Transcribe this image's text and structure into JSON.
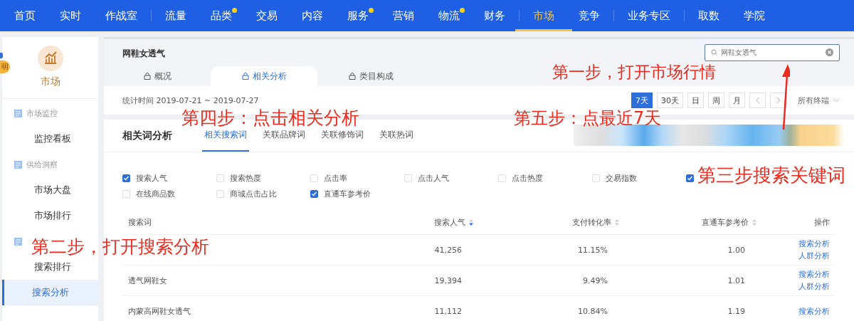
{
  "top_nav": {
    "groups": [
      {
        "items": [
          {
            "label": "首页",
            "selected": false,
            "dot": false
          },
          {
            "label": "实时",
            "selected": false,
            "dot": false
          },
          {
            "label": "作战室",
            "selected": false,
            "dot": false
          }
        ]
      },
      {
        "items": [
          {
            "label": "流量",
            "selected": false,
            "dot": false
          },
          {
            "label": "品类",
            "selected": false,
            "dot": true
          },
          {
            "label": "交易",
            "selected": false,
            "dot": false
          },
          {
            "label": "内容",
            "selected": false,
            "dot": false
          },
          {
            "label": "服务",
            "selected": false,
            "dot": true
          },
          {
            "label": "营销",
            "selected": false,
            "dot": false
          },
          {
            "label": "物流",
            "selected": false,
            "dot": true
          },
          {
            "label": "财务",
            "selected": false,
            "dot": false
          }
        ]
      },
      {
        "items": [
          {
            "label": "市场",
            "selected": true,
            "dot": false
          },
          {
            "label": "竞争",
            "selected": false,
            "dot": false
          }
        ]
      },
      {
        "items": [
          {
            "label": "业务专区",
            "selected": false,
            "dot": false
          }
        ]
      },
      {
        "items": [
          {
            "label": "取数",
            "selected": false,
            "dot": false
          },
          {
            "label": "学院",
            "selected": false,
            "dot": false
          }
        ]
      }
    ]
  },
  "side_badge": "明",
  "sidebar": {
    "title": "市场",
    "sections": [
      {
        "label": "市场监控",
        "items": [
          {
            "label": "监控看板",
            "selected": false
          }
        ]
      },
      {
        "label": "供给洞察",
        "items": [
          {
            "label": "市场大盘",
            "selected": false
          },
          {
            "label": "市场排行",
            "selected": false
          }
        ]
      },
      {
        "items": [
          {
            "label": "搜索排行",
            "selected": false
          },
          {
            "label": "搜索分析",
            "selected": true
          }
        ]
      }
    ]
  },
  "header": {
    "title": "网鞋女透气",
    "tabs": [
      {
        "label": "概况",
        "selected": false
      },
      {
        "label": "相关分析",
        "selected": true
      },
      {
        "label": "类目构成",
        "selected": false
      }
    ],
    "search": {
      "value": "网鞋女透气"
    }
  },
  "period": {
    "label": "统计时间 2019-07-21 ~ 2019-07-27",
    "buttons": [
      {
        "kind": "text",
        "label": "7天",
        "selected": true
      },
      {
        "kind": "text",
        "label": "30天",
        "selected": false
      },
      {
        "kind": "text",
        "label": "日",
        "selected": false
      },
      {
        "kind": "text",
        "label": "周",
        "selected": false
      },
      {
        "kind": "text",
        "label": "月",
        "selected": false
      },
      {
        "kind": "prev",
        "selected": false
      },
      {
        "kind": "next",
        "selected": false
      }
    ],
    "device": "所有终端"
  },
  "card": {
    "title": "相关词分析",
    "tabs": [
      {
        "label": "相关搜索词",
        "selected": true
      },
      {
        "label": "关联品牌词",
        "selected": false
      },
      {
        "label": "关联修饰词",
        "selected": false
      },
      {
        "label": "关联热词",
        "selected": false
      }
    ],
    "metrics": [
      {
        "label": "搜索人气",
        "checked": true
      },
      {
        "label": "搜索热度",
        "checked": false
      },
      {
        "label": "点击率",
        "checked": false
      },
      {
        "label": "点击人气",
        "checked": false
      },
      {
        "label": "点击热度",
        "checked": false
      },
      {
        "label": "交易指数",
        "checked": false
      },
      {
        "checked": true
      },
      {
        "label": "在线商品数",
        "checked": false
      },
      {
        "label": "商城点击占比",
        "checked": false
      },
      {
        "label": "直通车参考价",
        "checked": true
      }
    ],
    "table": {
      "columns": [
        {
          "label": "搜索词"
        },
        {
          "label": "搜索人气",
          "sortable": true,
          "sorted": true
        },
        {
          "label": "支付转化率",
          "sortable": true,
          "sorted": false
        },
        {
          "label": "直通车参考价",
          "sortable": true,
          "sorted": false
        },
        {
          "label": "操作"
        }
      ],
      "rows": [
        {
          "popularity": "41,256",
          "conversion": "11.15%",
          "cpc": "1.00",
          "actions": [
            "搜索分析",
            "人群分析"
          ]
        },
        {
          "keyword": "透气网鞋女",
          "popularity": "19,394",
          "conversion": "9.49%",
          "cpc": "1.01",
          "actions": [
            "搜索分析",
            "人群分析"
          ]
        },
        {
          "keyword": "内蒙高网鞋女透气",
          "popularity": "11,112",
          "conversion": "10.84%",
          "cpc": "1.19",
          "actions": [
            "搜索分析"
          ]
        }
      ]
    }
  },
  "annotations": [
    {
      "kind": "text",
      "text": "第一步，打开市场行情"
    },
    {
      "kind": "arrow"
    },
    {
      "kind": "text",
      "text": "第四步：点击相关分析"
    },
    {
      "kind": "text",
      "text": "第五步：点最近7天"
    },
    {
      "kind": "text",
      "text": "第三步搜索关键词"
    },
    {
      "kind": "text",
      "text": "第二步，打开搜索分析"
    }
  ]
}
